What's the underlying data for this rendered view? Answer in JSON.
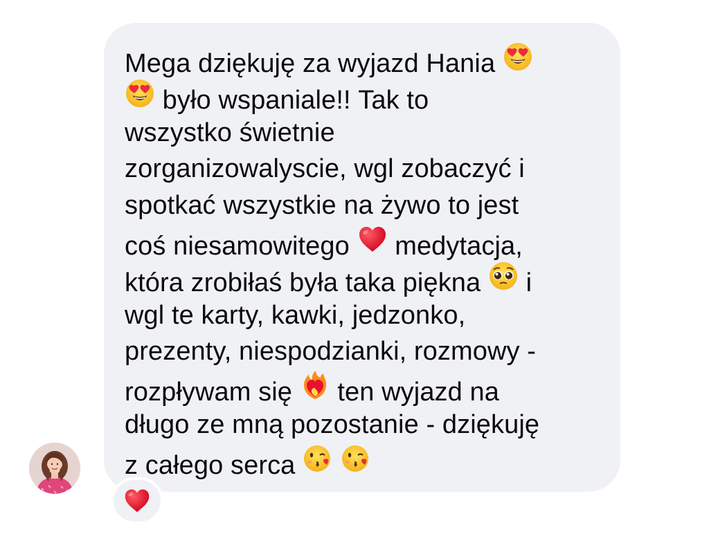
{
  "message": {
    "lines": [
      [
        "Mega dziękuję za wyjazd Hania ",
        {
          "emoji": "heart-eyes"
        }
      ],
      [
        {
          "emoji": "heart-eyes"
        },
        " było wspaniale!! Tak to"
      ],
      [
        "wszystko świetnie"
      ],
      [
        "zorganizowalyscie, wgl zobaczyć i"
      ],
      [
        "spotkać wszystkie na żywo to jest"
      ],
      [
        "coś niesamowitego ",
        {
          "emoji": "red-heart"
        },
        " medytacja,"
      ],
      [
        "która zrobiłaś była taka piękna ",
        {
          "emoji": "pleading-face"
        },
        " i"
      ],
      [
        "wgl te karty, kawki, jedzonko,"
      ],
      [
        "prezenty, niespodzianki, rozmowy -"
      ],
      [
        "rozpływam się ",
        {
          "emoji": "heart-on-fire"
        },
        " ten wyjazd na"
      ],
      [
        "długo ze mną pozostanie - dziękuję"
      ],
      [
        "z całego serca ",
        {
          "emoji": "face-blowing-kiss"
        },
        " ",
        {
          "emoji": "face-blowing-kiss"
        }
      ]
    ]
  },
  "reaction": {
    "emoji": "red-heart"
  },
  "sender": {
    "avatar_icon": "avatar-woman"
  },
  "colors": {
    "bubble": "#f0f1f5",
    "text": "#0a0a0a",
    "heart": "#e8112d"
  }
}
